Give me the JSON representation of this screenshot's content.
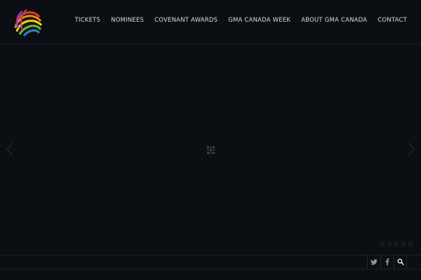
{
  "nav": {
    "items": [
      {
        "label": "TICKETS"
      },
      {
        "label": "NOMINEES"
      },
      {
        "label": "COVENANT AWARDS"
      },
      {
        "label": "GMA CANADA WEEK"
      },
      {
        "label": "ABOUT GMA CANADA"
      },
      {
        "label": "CONTACT"
      }
    ]
  },
  "logo": {
    "icon": "gma-globe-logo-icon"
  },
  "slider": {
    "prev_icon": "chevron-left-icon",
    "next_icon": "chevron-right-icon",
    "loader_icon": "loading-icon",
    "dot_count": 5
  },
  "social": {
    "twitter_icon": "twitter-icon",
    "facebook_icon": "facebook-icon",
    "search_icon": "search-icon"
  },
  "colors": {
    "background": "#0b0f13",
    "nav_text": "#d9dde1",
    "divider": "#1a2027"
  }
}
